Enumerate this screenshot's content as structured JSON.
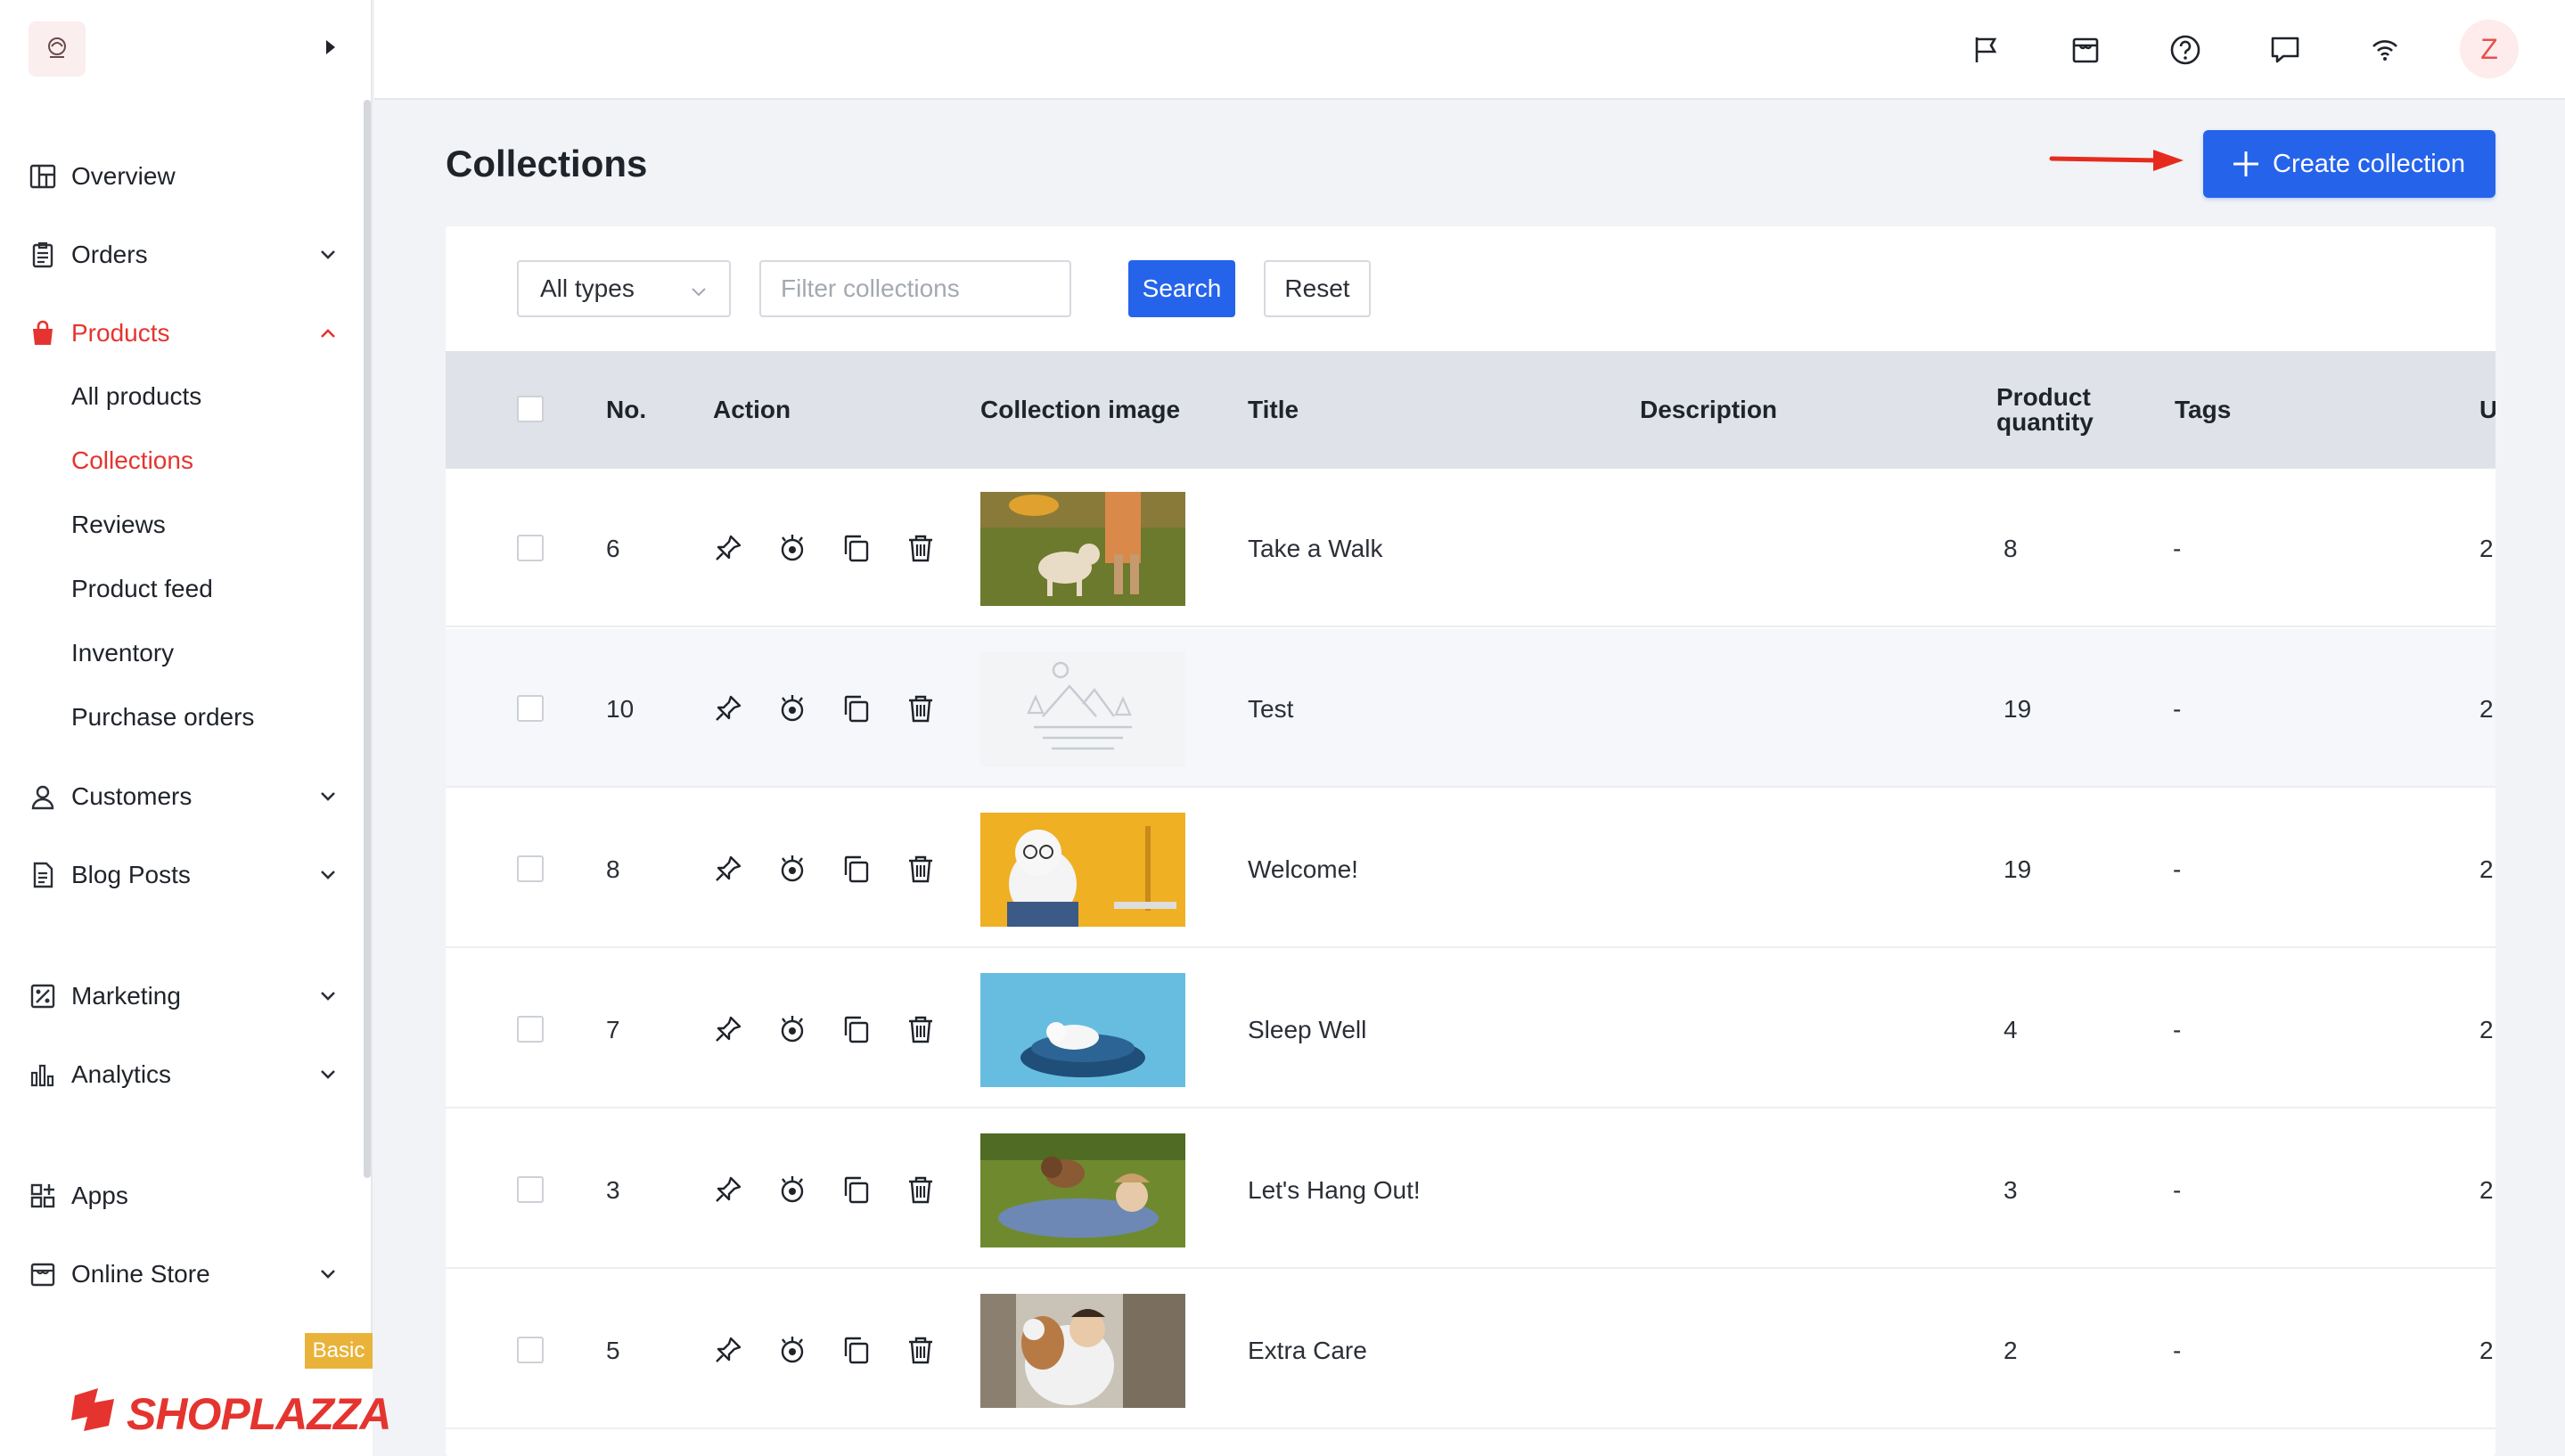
{
  "colors": {
    "accent": "#2563eb",
    "brand_red": "#e5342f",
    "badge": "#e9b33a"
  },
  "sidebar": {
    "items": [
      {
        "label": "Overview",
        "icon": "dashboard-icon",
        "expandable": false
      },
      {
        "label": "Orders",
        "icon": "clipboard-icon",
        "expandable": true
      },
      {
        "label": "Products",
        "icon": "shopping-bag-icon",
        "expandable": true,
        "expanded": true,
        "active": true
      },
      {
        "label": "Customers",
        "icon": "user-icon",
        "expandable": true
      },
      {
        "label": "Blog Posts",
        "icon": "document-icon",
        "expandable": true
      },
      {
        "label": "Marketing",
        "icon": "marketing-icon",
        "expandable": true
      },
      {
        "label": "Analytics",
        "icon": "bar-chart-icon",
        "expandable": true
      },
      {
        "label": "Apps",
        "icon": "apps-icon",
        "expandable": false
      },
      {
        "label": "Online Store",
        "icon": "store-icon",
        "expandable": true
      }
    ],
    "product_subitems": [
      {
        "label": "All products"
      },
      {
        "label": "Collections",
        "active": true
      },
      {
        "label": "Reviews"
      },
      {
        "label": "Product feed"
      },
      {
        "label": "Inventory"
      },
      {
        "label": "Purchase orders"
      }
    ],
    "plan_badge": "Basic",
    "brand_name": "SHOPLAZZA"
  },
  "topbar": {
    "icons": [
      "flag-icon",
      "store-icon",
      "help-icon",
      "chat-icon",
      "wifi-icon"
    ],
    "avatar_initial": "Z"
  },
  "page": {
    "title": "Collections",
    "create_button": "Create collection"
  },
  "filters": {
    "type_select": "All types",
    "search_placeholder": "Filter collections",
    "search_button": "Search",
    "reset_button": "Reset"
  },
  "table": {
    "columns": {
      "no": "No.",
      "action": "Action",
      "image": "Collection image",
      "title": "Title",
      "description": "Description",
      "quantity_line1": "Product",
      "quantity_line2": "quantity",
      "tags": "Tags",
      "updated": "U"
    },
    "rows": [
      {
        "no": "6",
        "title": "Take a Walk",
        "description": "",
        "quantity": "8",
        "tags": "-",
        "updated": "2",
        "image": "photo-dog-walk"
      },
      {
        "no": "10",
        "title": "Test",
        "description": "",
        "quantity": "19",
        "tags": "-",
        "updated": "2",
        "image": "placeholder-image"
      },
      {
        "no": "8",
        "title": "Welcome!",
        "description": "",
        "quantity": "19",
        "tags": "-",
        "updated": "2",
        "image": "photo-dog-laptop"
      },
      {
        "no": "7",
        "title": "Sleep Well",
        "description": "",
        "quantity": "4",
        "tags": "-",
        "updated": "2",
        "image": "photo-dog-bed"
      },
      {
        "no": "3",
        "title": "Let's Hang Out!",
        "description": "",
        "quantity": "3",
        "tags": "-",
        "updated": "2",
        "image": "photo-dog-grass"
      },
      {
        "no": "5",
        "title": "Extra Care",
        "description": "",
        "quantity": "2",
        "tags": "-",
        "updated": "2",
        "image": "photo-dog-hug"
      }
    ],
    "row_actions": [
      "pin-icon",
      "eye-icon",
      "copy-icon",
      "trash-icon"
    ]
  }
}
